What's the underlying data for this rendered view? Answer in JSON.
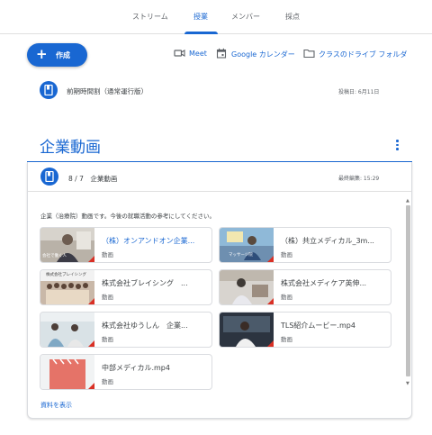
{
  "nav": {
    "tabs": [
      {
        "label": "ストリーム"
      },
      {
        "label": "授業"
      },
      {
        "label": "メンバー"
      },
      {
        "label": "採点"
      }
    ]
  },
  "toolbar": {
    "create_label": "作成",
    "meet_label": "Meet",
    "calendar_label": "Google カレンダー",
    "drive_label": "クラスのドライブ フォルダ"
  },
  "assignment": {
    "title": "前期時間割（通常運行版）",
    "posted": "投稿日: 6月11日"
  },
  "topic": {
    "title": "企業動画"
  },
  "material": {
    "title": "8 / 7　企業動画",
    "edited": "最終編集: 15:29",
    "description": "企業（治療院）動画です。今後の就職活動の参考にしてください。",
    "show_all": "資料を表示",
    "attachments": [
      {
        "name": "（株）オンアンドオン企業...",
        "type": "動画",
        "thumb_text": "会社で働く人"
      },
      {
        "name": "（株）共立メディカル_3m...",
        "type": "動画",
        "thumb_text": "マッサージ院"
      },
      {
        "name": "株式会社ブレイシング　...",
        "type": "動画",
        "thumb_text": "株式会社ブレイシング"
      },
      {
        "name": "株式会社メディケア英伸...",
        "type": "動画",
        "thumb_text": ""
      },
      {
        "name": "株式会社ゆうしん　企業...",
        "type": "動画",
        "thumb_text": ""
      },
      {
        "name": "TLS紹介ムービー.mp4",
        "type": "動画",
        "thumb_text": ""
      },
      {
        "name": "中部メディカル.mp4",
        "type": "動画",
        "thumb_text": ""
      }
    ]
  },
  "colors": {
    "accent": "#1967d2",
    "video_red": "#d93025"
  }
}
